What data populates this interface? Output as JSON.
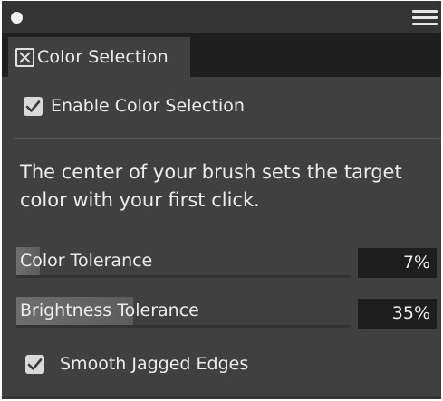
{
  "panel": {
    "tab_label": "Color Selection",
    "tab_icon": "close-box-icon",
    "menu_icon": "hamburger-menu-icon"
  },
  "enable": {
    "label": "Enable Color Selection",
    "checked": true
  },
  "description": "The center of your brush sets the target color with your first click.",
  "sliders": [
    {
      "label": "Color Tolerance",
      "value_text": "7%",
      "value": 7
    },
    {
      "label": "Brightness Tolerance",
      "value_text": "35%",
      "value": 35
    }
  ],
  "smooth": {
    "label": "Smooth Jagged Edges",
    "checked": true
  },
  "colors": {
    "panel_bg": "#404040",
    "titlebar_bg": "#343434",
    "tabstrip_bg": "#1f1f1f",
    "text": "#ececec",
    "value_bg": "#1e1e1e"
  }
}
